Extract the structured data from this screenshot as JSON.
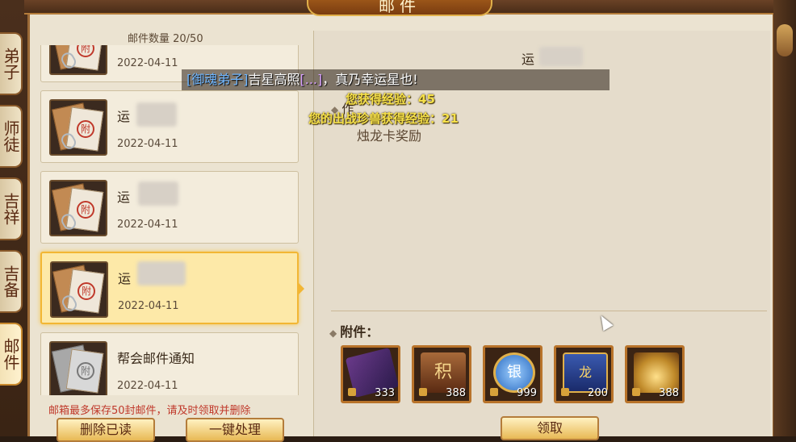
{
  "window": {
    "title": "邮件"
  },
  "side_tabs": [
    {
      "label": "弟子"
    },
    {
      "label": "师徒"
    },
    {
      "label": "吉祥"
    },
    {
      "label": "吉备"
    },
    {
      "label": "邮件"
    }
  ],
  "list": {
    "count_label": "邮件数量 20/50",
    "items": [
      {
        "title": "",
        "date": "2022-04-11"
      },
      {
        "title": "运",
        "date": "2022-04-11"
      },
      {
        "title": "运",
        "date": "2022-04-11"
      },
      {
        "title": "运",
        "date": "2022-04-11",
        "selected": true
      },
      {
        "title": "帮会邮件通知",
        "date": "2022-04-11"
      }
    ],
    "footer_note": "邮箱最多保存50封邮件，请及时领取并删除",
    "delete_read_label": "删除已读",
    "one_click_label": "一键处理"
  },
  "detail": {
    "title": "运",
    "sender": "作",
    "body": "烛龙卡奖励",
    "exp_line": "您获得经验：45",
    "pet_exp_line": "您的出战珍兽获得经验：21",
    "attachments_label": "附件：",
    "attachments": [
      {
        "icon": "card-icon",
        "count": "333",
        "color": "#6a3a8a"
      },
      {
        "icon": "points-chest-icon",
        "count": "388",
        "color": "#8a4a1a",
        "glyph": "积"
      },
      {
        "icon": "silver-coin-icon",
        "count": "999",
        "color": "#3a7ad0",
        "glyph": "银"
      },
      {
        "icon": "dragon-chest-icon",
        "count": "200",
        "color": "#2a4a9a",
        "glyph": "龙"
      },
      {
        "icon": "gold-chest-icon",
        "count": "388",
        "color": "#c08a2a"
      }
    ],
    "claim_label": "领取"
  },
  "announcement": {
    "name": "[御魂弟子]",
    "text1": "吉星高照",
    "item": "[...]",
    "text2": "，真乃幸运星也!"
  }
}
